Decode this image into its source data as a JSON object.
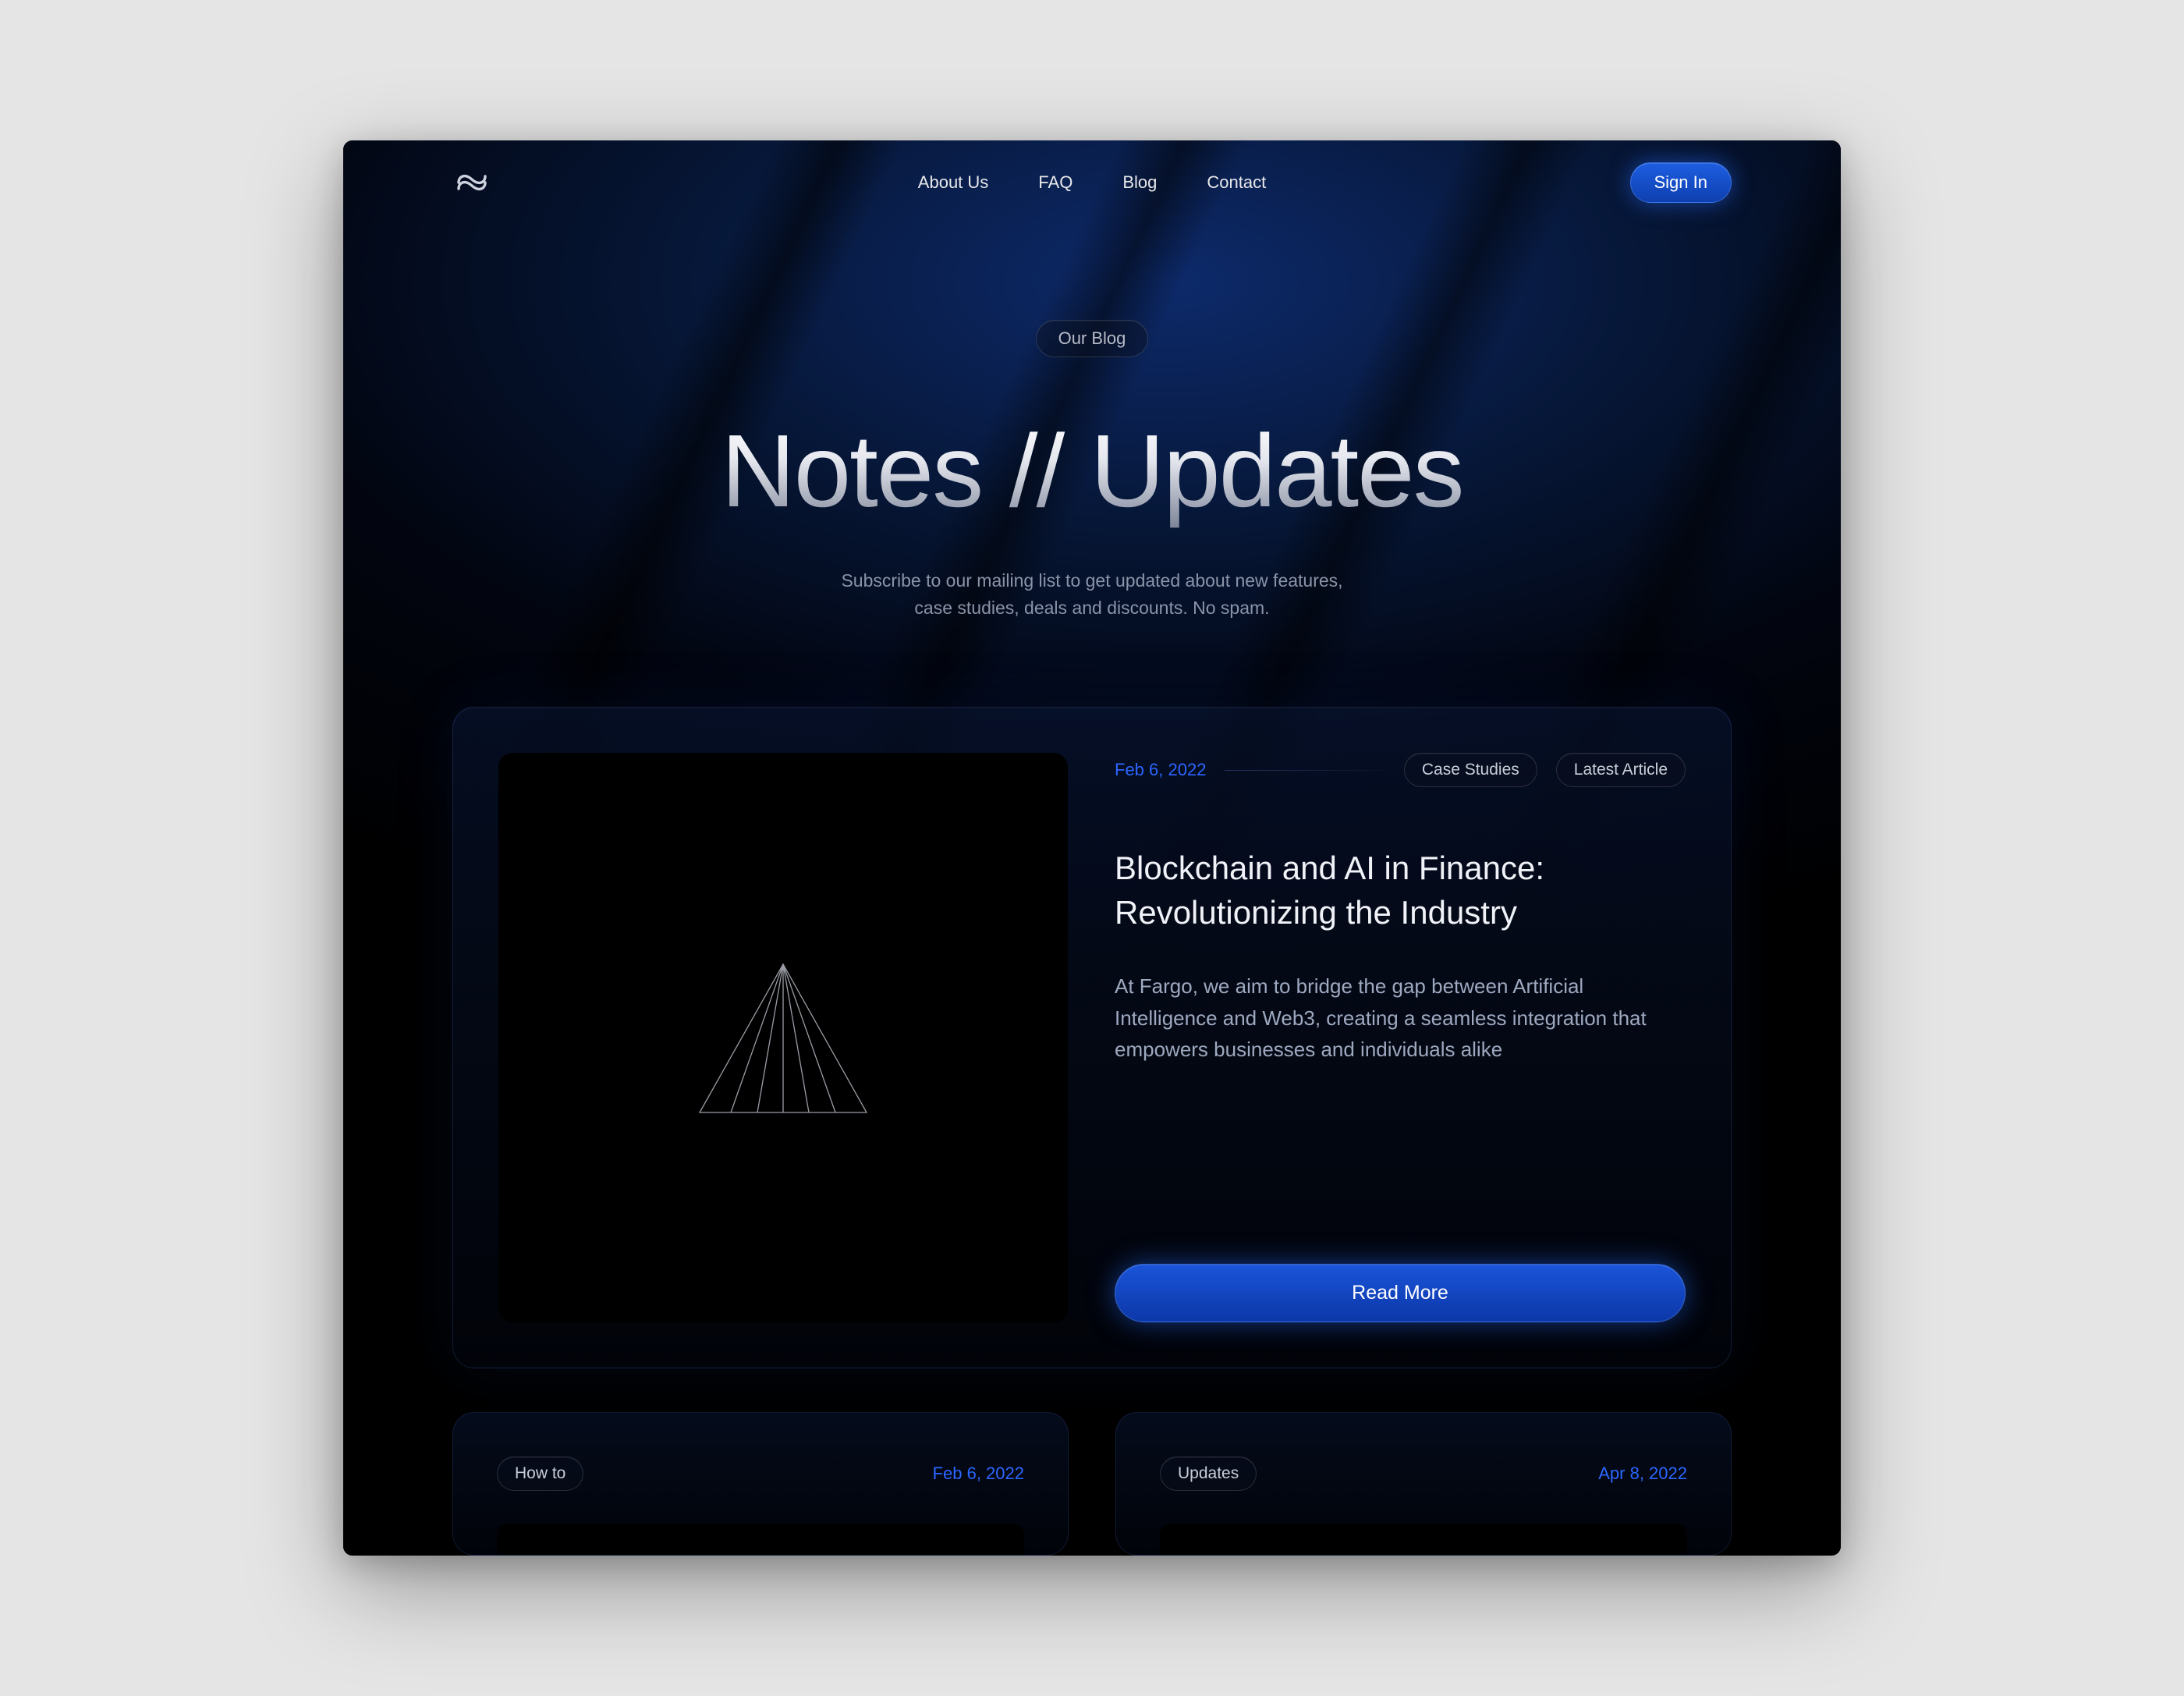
{
  "nav": {
    "links": [
      "About Us",
      "FAQ",
      "Blog",
      "Contact"
    ],
    "signin": "Sign In"
  },
  "hero": {
    "badge": "Our Blog",
    "title": "Notes // Updates",
    "subtitle_l1": "Subscribe to our mailing list to get updated about new features,",
    "subtitle_l2": "case studies, deals and discounts. No spam."
  },
  "featured": {
    "date": "Feb 6, 2022",
    "tags": [
      "Case Studies",
      "Latest Article"
    ],
    "title_l1": "Blockchain and AI in Finance:",
    "title_l2": "Revolutionizing the Industry",
    "excerpt": "At Fargo, we aim to bridge the gap between Artificial Intelligence and Web3, creating a seamless integration that empowers businesses and individuals alike",
    "cta": "Read More"
  },
  "cards": [
    {
      "tag": "How to",
      "date": "Feb 6, 2022"
    },
    {
      "tag": "Updates",
      "date": "Apr 8, 2022"
    }
  ],
  "colors": {
    "accent": "#1a54d8",
    "link": "#2b66ff"
  }
}
